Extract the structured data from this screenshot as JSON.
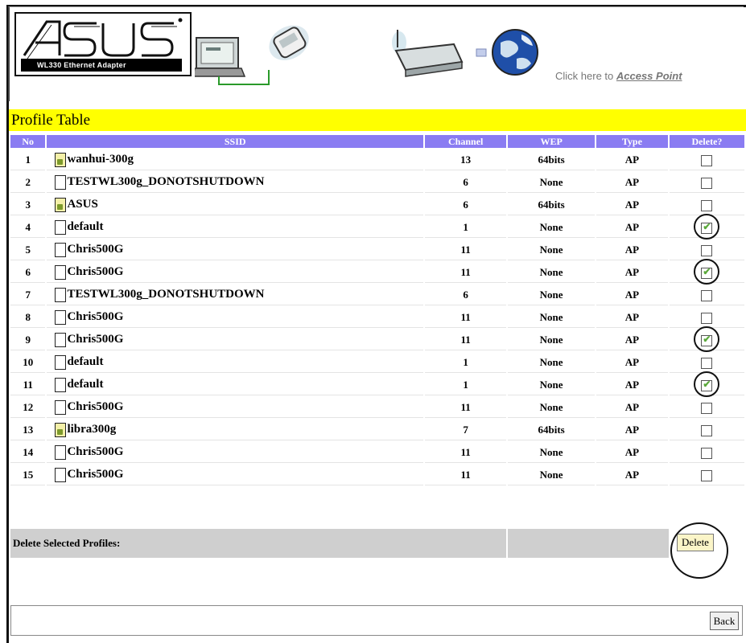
{
  "header": {
    "brand": "ASUS",
    "product_strip": "WL330 Ethernet Adapter",
    "access_prefix": "Click here to ",
    "access_link": "Access Point"
  },
  "profile_table": {
    "title": "Profile Table",
    "columns": {
      "no": "No",
      "ssid": "SSID",
      "channel": "Channel",
      "wep": "WEP",
      "type": "Type",
      "delete": "Delete?"
    },
    "rows": [
      {
        "no": "1",
        "ssid": "wanhui-300g",
        "channel": "13",
        "wep": "64bits",
        "type": "AP",
        "secure": true,
        "checked": false
      },
      {
        "no": "2",
        "ssid": "TESTWL300g_DONOTSHUTDOWN",
        "channel": "6",
        "wep": "None",
        "type": "AP",
        "secure": false,
        "checked": false
      },
      {
        "no": "3",
        "ssid": "ASUS",
        "channel": "6",
        "wep": "64bits",
        "type": "AP",
        "secure": true,
        "checked": false
      },
      {
        "no": "4",
        "ssid": "default",
        "channel": "1",
        "wep": "None",
        "type": "AP",
        "secure": false,
        "checked": true
      },
      {
        "no": "5",
        "ssid": "Chris500G",
        "channel": "11",
        "wep": "None",
        "type": "AP",
        "secure": false,
        "checked": false
      },
      {
        "no": "6",
        "ssid": "Chris500G",
        "channel": "11",
        "wep": "None",
        "type": "AP",
        "secure": false,
        "checked": true
      },
      {
        "no": "7",
        "ssid": "TESTWL300g_DONOTSHUTDOWN",
        "channel": "6",
        "wep": "None",
        "type": "AP",
        "secure": false,
        "checked": false
      },
      {
        "no": "8",
        "ssid": "Chris500G",
        "channel": "11",
        "wep": "None",
        "type": "AP",
        "secure": false,
        "checked": false
      },
      {
        "no": "9",
        "ssid": "Chris500G",
        "channel": "11",
        "wep": "None",
        "type": "AP",
        "secure": false,
        "checked": true
      },
      {
        "no": "10",
        "ssid": "default",
        "channel": "1",
        "wep": "None",
        "type": "AP",
        "secure": false,
        "checked": false
      },
      {
        "no": "11",
        "ssid": "default",
        "channel": "1",
        "wep": "None",
        "type": "AP",
        "secure": false,
        "checked": true
      },
      {
        "no": "12",
        "ssid": "Chris500G",
        "channel": "11",
        "wep": "None",
        "type": "AP",
        "secure": false,
        "checked": false
      },
      {
        "no": "13",
        "ssid": "libra300g",
        "channel": "7",
        "wep": "64bits",
        "type": "AP",
        "secure": true,
        "checked": false
      },
      {
        "no": "14",
        "ssid": "Chris500G",
        "channel": "11",
        "wep": "None",
        "type": "AP",
        "secure": false,
        "checked": false
      },
      {
        "no": "15",
        "ssid": "Chris500G",
        "channel": "11",
        "wep": "None",
        "type": "AP",
        "secure": false,
        "checked": false
      }
    ],
    "delete_label": "Delete Selected Profiles:",
    "delete_button": "Delete"
  },
  "footer": {
    "back_button": "Back"
  },
  "colors": {
    "title_bar": "#ffff00",
    "header_row": "#8a7cf2",
    "delete_bar": "#cfcfcf",
    "button_fill": "#fbf5c8"
  },
  "icons": [
    "asus-logo",
    "laptop-adapter-icon",
    "router-icon",
    "globe-icon",
    "profile-document-icon",
    "secure-profile-icon"
  ]
}
